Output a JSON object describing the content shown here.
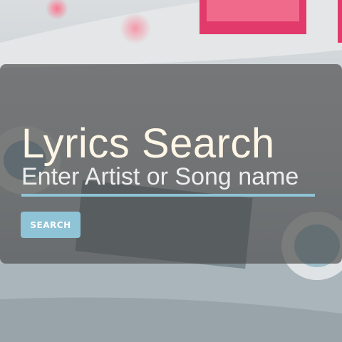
{
  "header": {
    "title": "Lyrics Search"
  },
  "search": {
    "placeholder": "Enter Artist or Song name",
    "value": "",
    "button_label": "SEARCH"
  },
  "colors": {
    "accent": "#8fc3d6",
    "overlay": "#464646",
    "title_text": "#fff6e6"
  }
}
